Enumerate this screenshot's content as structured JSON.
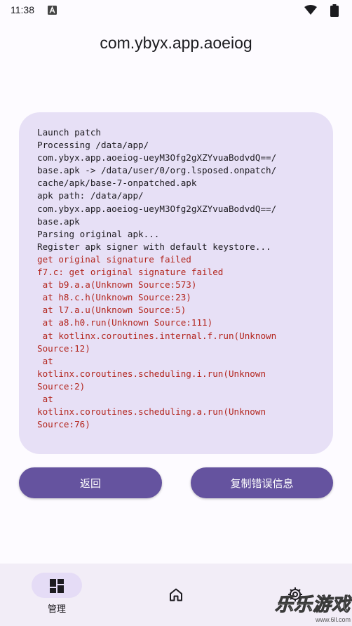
{
  "status_bar": {
    "time": "11:38"
  },
  "app_title": "com.ybyx.app.aoeiog",
  "log": [
    {
      "text": "Launch patch",
      "error": false
    },
    {
      "text": "Processing /data/app/",
      "error": false
    },
    {
      "text": "com.ybyx.app.aoeiog-ueyM3Ofg2gXZYvuaBodvdQ==/",
      "error": false
    },
    {
      "text": "base.apk -> /data/user/0/org.lsposed.onpatch/",
      "error": false
    },
    {
      "text": "cache/apk/base-7-onpatched.apk",
      "error": false
    },
    {
      "text": "apk path: /data/app/",
      "error": false
    },
    {
      "text": "com.ybyx.app.aoeiog-ueyM3Ofg2gXZYvuaBodvdQ==/",
      "error": false
    },
    {
      "text": "base.apk",
      "error": false
    },
    {
      "text": "Parsing original apk...",
      "error": false
    },
    {
      "text": "Register apk signer with default keystore...",
      "error": false
    },
    {
      "text": "get original signature failed",
      "error": true
    },
    {
      "text": "f7.c: get original signature failed",
      "error": true
    },
    {
      "text": " at b9.a.a(Unknown Source:573)",
      "error": true
    },
    {
      "text": " at h8.c.h(Unknown Source:23)",
      "error": true
    },
    {
      "text": " at l7.a.u(Unknown Source:5)",
      "error": true
    },
    {
      "text": " at a8.h0.run(Unknown Source:111)",
      "error": true
    },
    {
      "text": " at kotlinx.coroutines.internal.f.run(Unknown",
      "error": true
    },
    {
      "text": "Source:12)",
      "error": true
    },
    {
      "text": " at",
      "error": true
    },
    {
      "text": "kotlinx.coroutines.scheduling.i.run(Unknown",
      "error": true
    },
    {
      "text": "Source:2)",
      "error": true
    },
    {
      "text": " at",
      "error": true
    },
    {
      "text": "kotlinx.coroutines.scheduling.a.run(Unknown",
      "error": true
    },
    {
      "text": "Source:76)",
      "error": true
    }
  ],
  "buttons": {
    "back_label": "返回",
    "copy_label": "复制错误信息"
  },
  "bottom_nav": {
    "items": [
      {
        "label": "管理",
        "icon": "dashboard-icon",
        "selected": true
      },
      {
        "label": "",
        "icon": "home-icon",
        "selected": false
      },
      {
        "label": "",
        "icon": "settings-icon",
        "selected": false
      }
    ]
  },
  "watermark": {
    "main": "乐乐游戏",
    "sub": "www.6ll.com"
  },
  "colors": {
    "background": "#fdfbff",
    "card": "#e7e0f6",
    "error_text": "#b3261e",
    "button": "#65539f",
    "nav_bg": "#f2edf7",
    "nav_pill": "#e5dcf6"
  }
}
